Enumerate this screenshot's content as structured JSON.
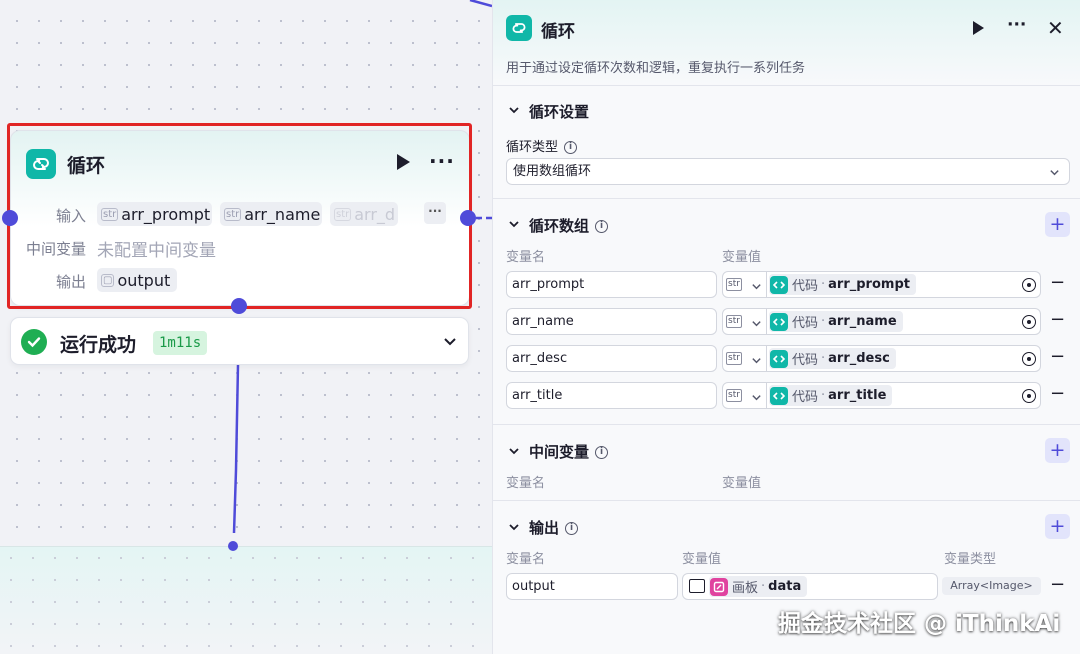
{
  "node": {
    "title": "循环",
    "input_label": "输入",
    "inputs": [
      {
        "type": "str",
        "name": "arr_prompt"
      },
      {
        "type": "str",
        "name": "arr_name"
      },
      {
        "type": "str",
        "name": "arr_d"
      }
    ],
    "more_label": "···",
    "intermediate_label": "中间变量",
    "intermediate_placeholder": "未配置中间变量",
    "output_label": "输出",
    "output_name": "output"
  },
  "run": {
    "status": "运行成功",
    "duration": "1m11s"
  },
  "panel": {
    "title": "循环",
    "description": "用于通过设定循环次数和逻辑，重复执行一系列任务",
    "loop_settings": {
      "title": "循环设置",
      "type_label": "循环类型",
      "type_value": "使用数组循环"
    },
    "loop_array": {
      "title": "循环数组",
      "col_name": "变量名",
      "col_value": "变量值",
      "rows": [
        {
          "name": "arr_prompt",
          "type": "str",
          "source": "代码",
          "ref": "arr_prompt"
        },
        {
          "name": "arr_name",
          "type": "str",
          "source": "代码",
          "ref": "arr_name"
        },
        {
          "name": "arr_desc",
          "type": "str",
          "source": "代码",
          "ref": "arr_desc"
        },
        {
          "name": "arr_title",
          "type": "str",
          "source": "代码",
          "ref": "arr_title"
        }
      ]
    },
    "intermediate": {
      "title": "中间变量",
      "col_name": "变量名",
      "col_value": "变量值"
    },
    "output": {
      "title": "输出",
      "col_name": "变量名",
      "col_value": "变量值",
      "col_type": "变量类型",
      "row": {
        "name": "output",
        "source": "画板",
        "ref": "data",
        "type": "Array<Image>"
      }
    }
  },
  "watermark": "掘金技术社区 @ iThinkAi",
  "colors": {
    "accent": "#4f4bd9",
    "loop_icon": "#10b7a8",
    "success": "#1fae53",
    "selection": "#e12525",
    "image_source": "#e0439f"
  }
}
